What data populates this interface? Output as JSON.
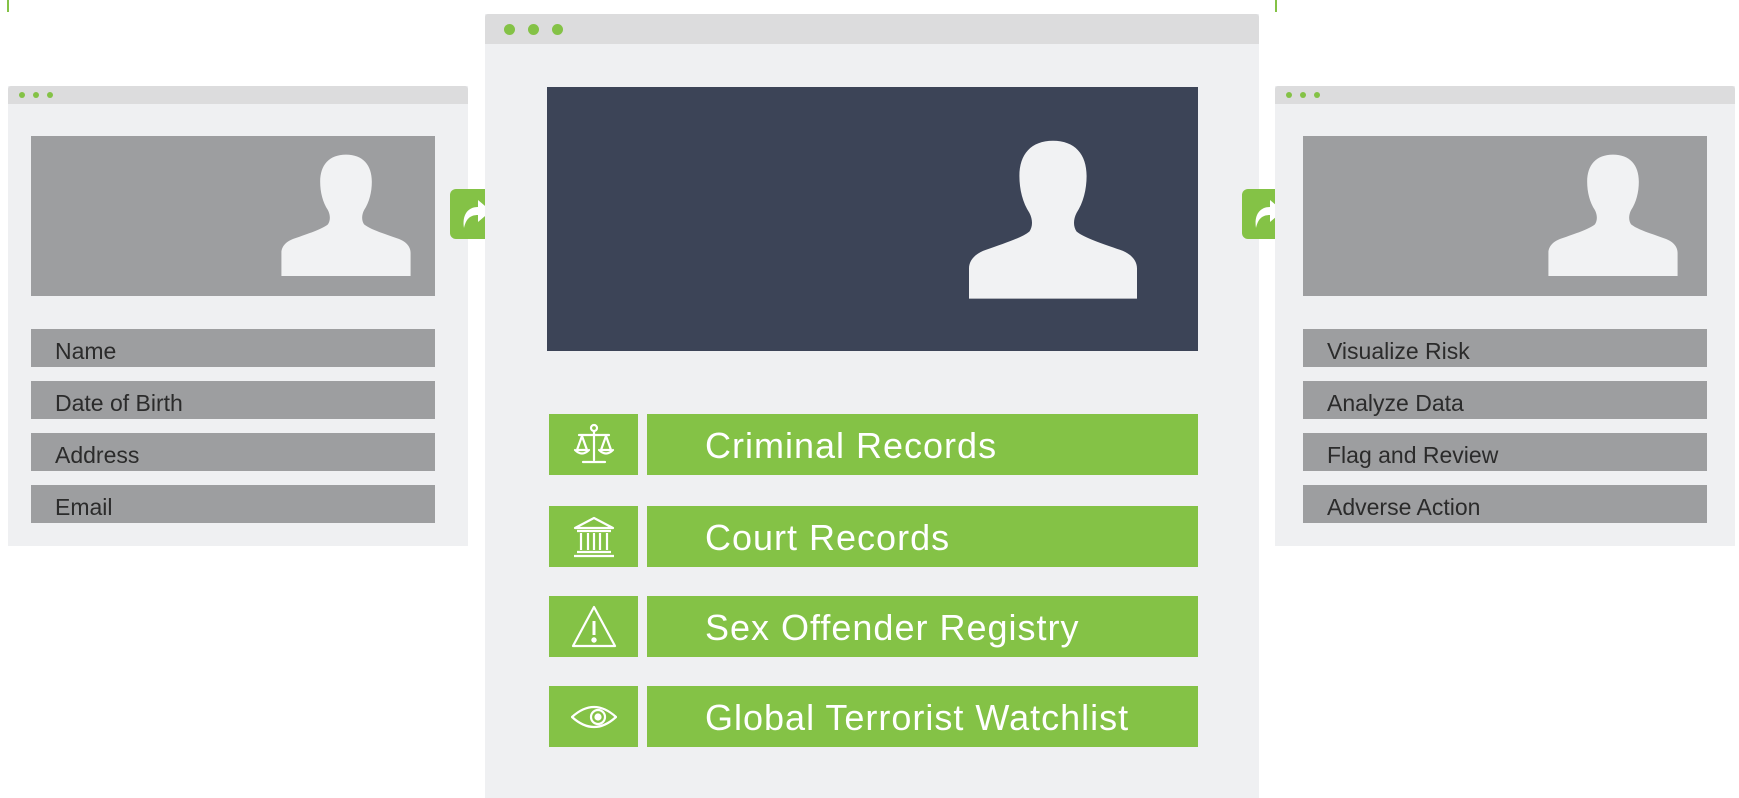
{
  "colors": {
    "accent_green": "#84c246",
    "window_bg": "#eff0f2",
    "titlebar": "#dcdcdd",
    "field_gray": "#9d9ea0",
    "hero_navy": "#3c4457",
    "silhouette": "#f1f2f3"
  },
  "left_panel": {
    "avatar_icon": "person-silhouette-icon",
    "fields": [
      "Name",
      "Date of Birth",
      "Address",
      "Email"
    ]
  },
  "center_panel": {
    "avatar_icon": "person-silhouette-icon",
    "records": [
      {
        "label": "Criminal Records",
        "icon": "scales-of-justice-icon"
      },
      {
        "label": "Court Records",
        "icon": "courthouse-icon"
      },
      {
        "label": "Sex Offender Registry",
        "icon": "warning-triangle-icon"
      },
      {
        "label": "Global Terrorist Watchlist",
        "icon": "eye-icon"
      }
    ]
  },
  "right_panel": {
    "avatar_icon": "person-silhouette-icon",
    "fields": [
      "Visualize Risk",
      "Analyze Data",
      "Flag and Review",
      "Adverse Action"
    ]
  },
  "connectors": {
    "icon": "forward-arrow-icon"
  }
}
